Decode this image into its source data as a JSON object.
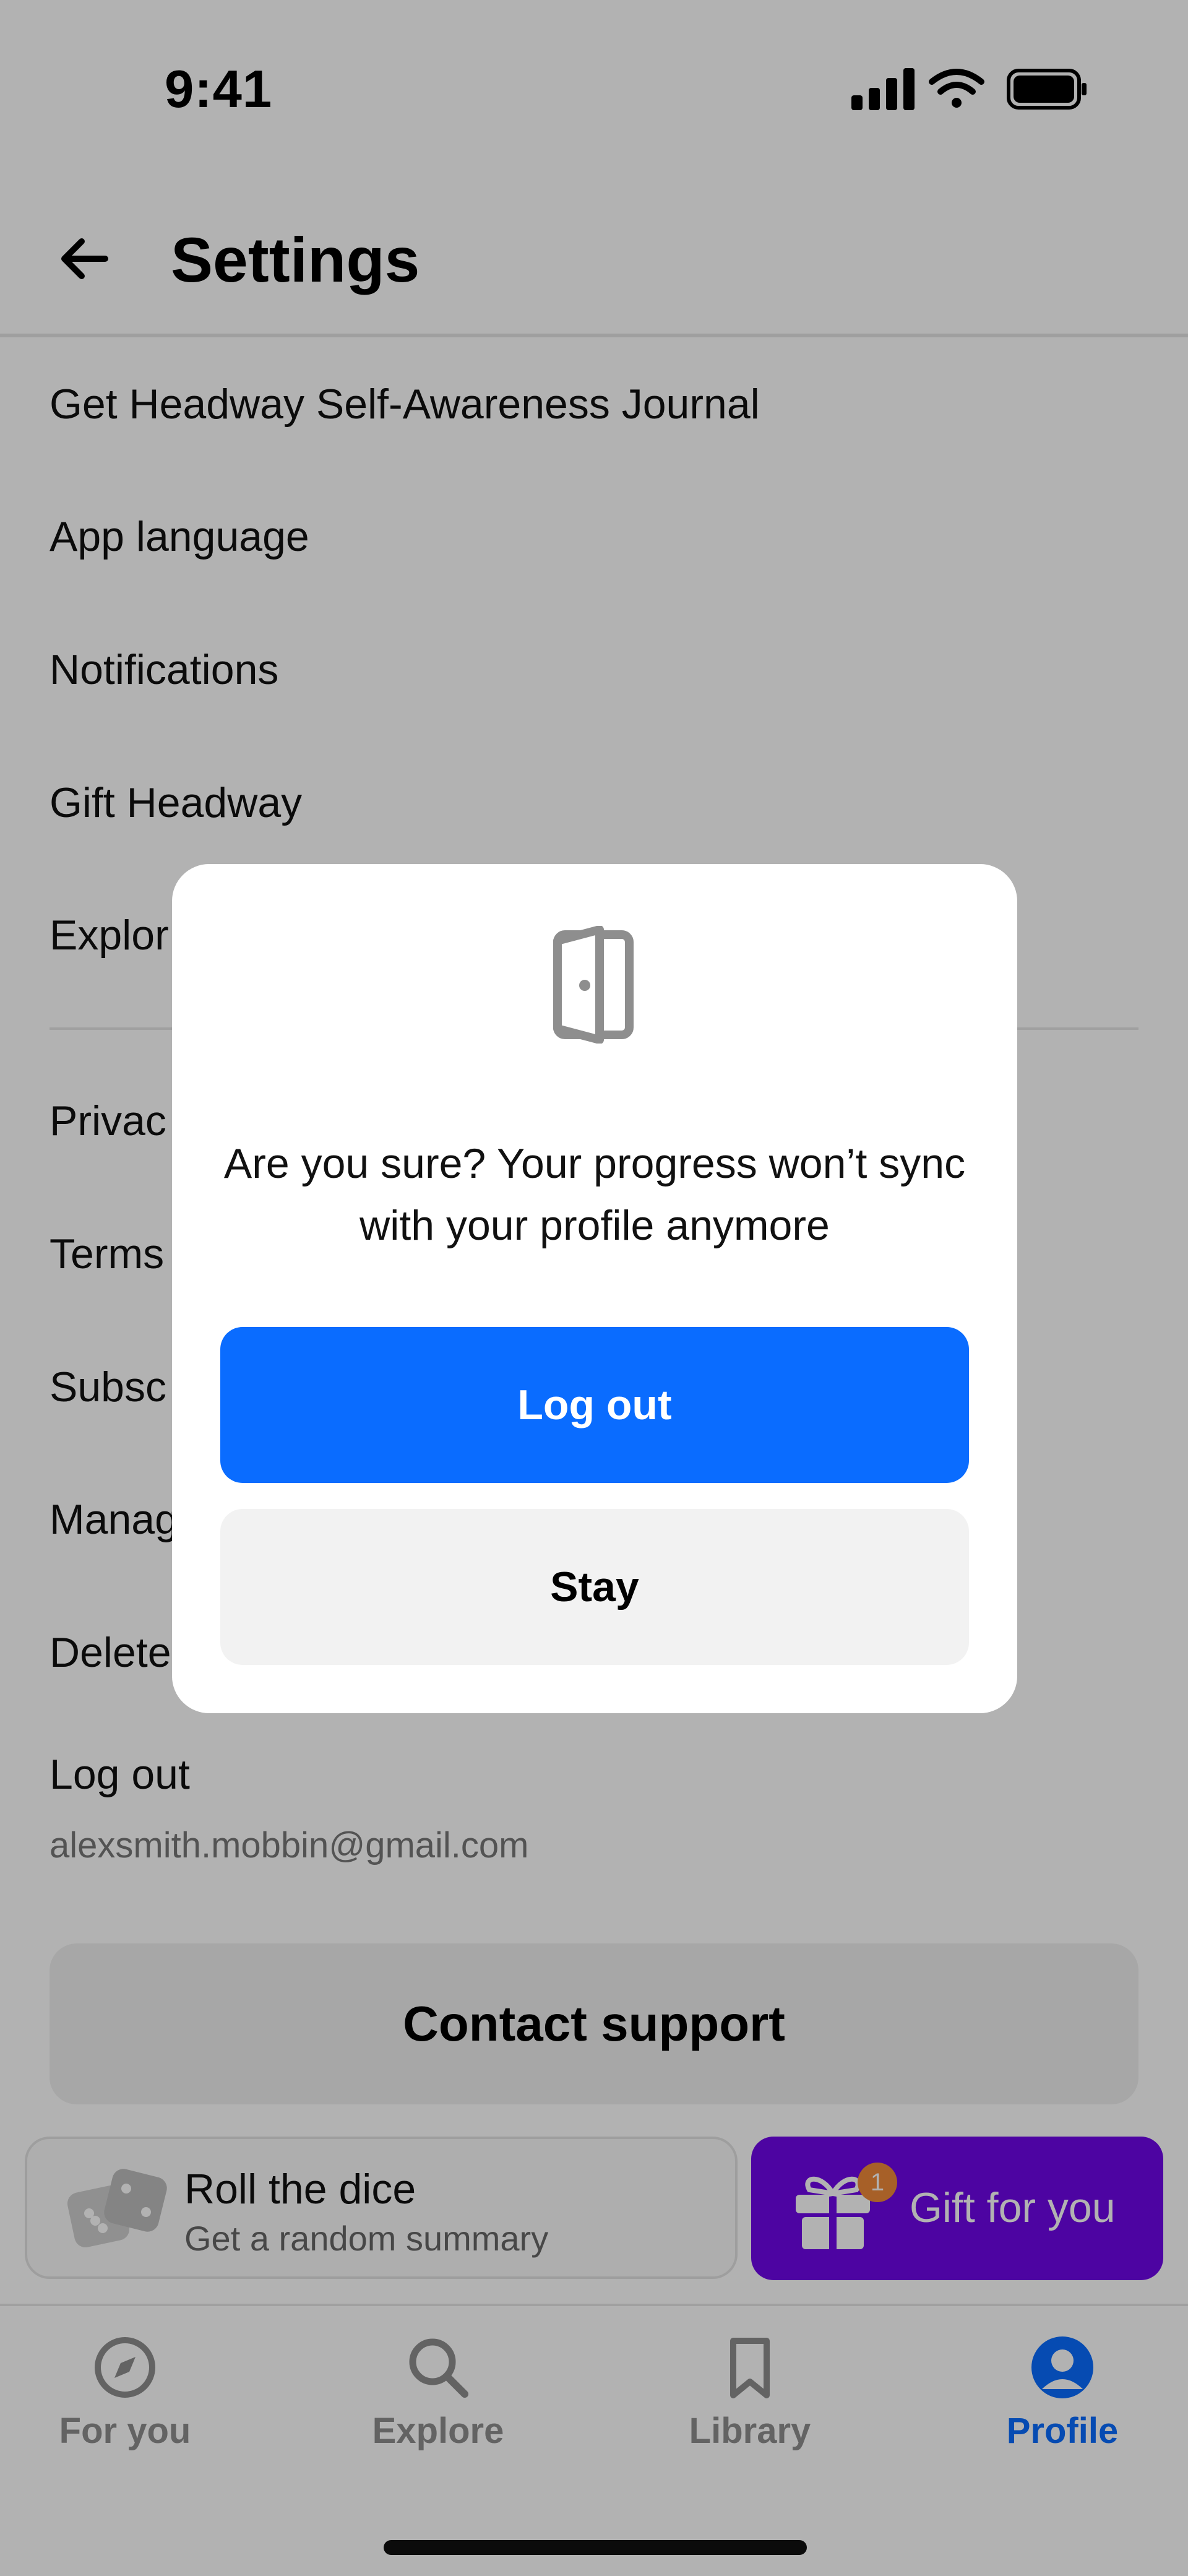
{
  "status_bar": {
    "time": "9:41",
    "icons": [
      "signal-icon",
      "wifi-icon",
      "battery-icon"
    ]
  },
  "header": {
    "title": "Settings",
    "back_icon": "arrow-left-icon"
  },
  "settings": {
    "items": [
      {
        "label": "Get Headway Self-Awareness Journal"
      },
      {
        "label": "App language"
      },
      {
        "label": "Notifications"
      },
      {
        "label": "Gift Headway"
      },
      {
        "label": "Explor"
      },
      {
        "label": "Privac"
      },
      {
        "label": "Terms"
      },
      {
        "label": "Subsc"
      },
      {
        "label": "Manag"
      },
      {
        "label": "Delete"
      },
      {
        "label": "Log out"
      }
    ],
    "email": "alexsmith.mobbin@gmail.com",
    "contact_support": "Contact support"
  },
  "promo": {
    "dice_title": "Roll the dice",
    "dice_subtitle": "Get a random summary",
    "gift_label": "Gift for you",
    "gift_badge": "1"
  },
  "tabs": [
    {
      "label": "For you",
      "icon": "compass-icon",
      "active": false
    },
    {
      "label": "Explore",
      "icon": "search-icon",
      "active": false
    },
    {
      "label": "Library",
      "icon": "bookmark-icon",
      "active": false
    },
    {
      "label": "Profile",
      "icon": "profile-icon",
      "active": true
    }
  ],
  "dialog": {
    "icon": "door-icon",
    "message": "Are you sure? Your progress won’t sync with your profile anymore",
    "primary_label": "Log out",
    "secondary_label": "Stay"
  },
  "colors": {
    "accent": "#0a6cff",
    "gift": "#6f06e8",
    "active_tab": "#0a6cff",
    "inactive_tab": "#8e8e8e"
  }
}
